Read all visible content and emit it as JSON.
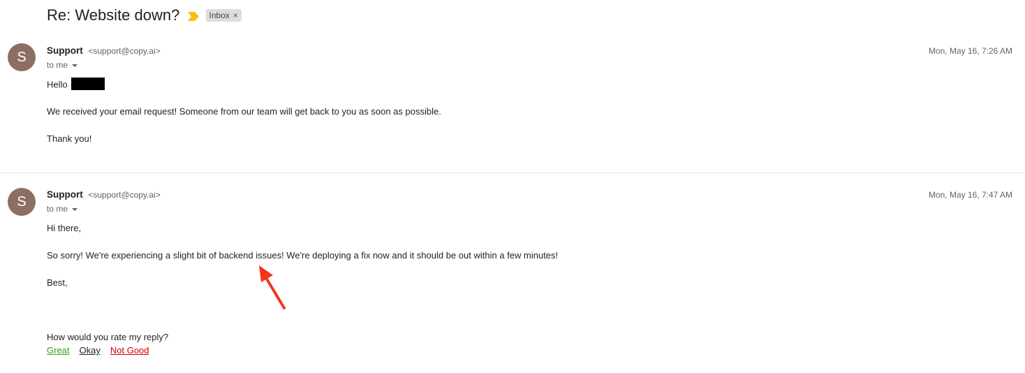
{
  "thread": {
    "subject": "Re: Website down?",
    "label": "Inbox",
    "label_remove": "×",
    "importance_color": "#f4c20d"
  },
  "messages": [
    {
      "avatar_letter": "S",
      "avatar_color": "#8d6e63",
      "sender_name": "Support",
      "sender_email": "<support@copy.ai>",
      "date": "Mon, May 16, 7:26 AM",
      "to": "to me",
      "greeting": "Hello",
      "body": "We received your email request! Someone from our team will get back to you as soon as possible.",
      "closing": "Thank you!"
    },
    {
      "avatar_letter": "S",
      "avatar_color": "#8d6e63",
      "sender_name": "Support",
      "sender_email": "<support@copy.ai>",
      "date": "Mon, May 16, 7:47 AM",
      "to": "to me",
      "greeting": "Hi there,",
      "body": "So sorry! We're experiencing a slight bit of backend issues! We're deploying a fix now and it should be out within a few minutes!",
      "closing": "Best,",
      "rating_prompt": "How would you rate my reply?",
      "rating_options": [
        {
          "label": "Great",
          "color": "#3c9a1e"
        },
        {
          "label": "Okay",
          "color": "#222222"
        },
        {
          "label": "Not Good",
          "color": "#d40000"
        }
      ]
    }
  ],
  "annotation_arrow_color": "#f4351c"
}
